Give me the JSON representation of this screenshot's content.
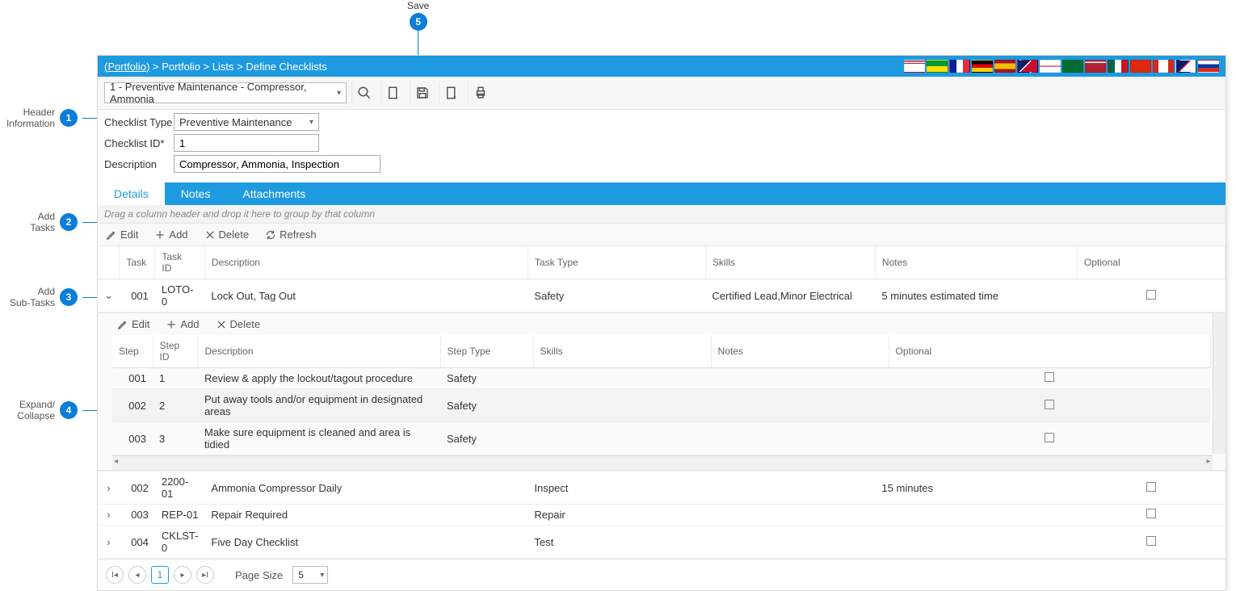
{
  "callouts": {
    "c1": "Header\nInformation",
    "c2": "Add\nTasks",
    "c3": "Add\nSub-Tasks",
    "c4": "Expand/\nCollapse",
    "c5": "Save"
  },
  "breadcrumb": {
    "root": "(Portfolio)",
    "parts": [
      "Portfolio",
      "Lists",
      "Define Checklists"
    ],
    "sep": " > "
  },
  "selector": {
    "value": "1 - Preventive Maintenance - Compressor, Ammonia"
  },
  "form": {
    "type_label": "Checklist Type",
    "type_value": "Preventive Maintenance",
    "id_label": "Checklist ID*",
    "id_value": "1",
    "desc_label": "Description",
    "desc_value": "Compressor, Ammonia, Inspection"
  },
  "tabs": {
    "details": "Details",
    "notes": "Notes",
    "attachments": "Attachments"
  },
  "group_hint": "Drag a column header and drop it here to group by that column",
  "actions": {
    "edit": "Edit",
    "add": "Add",
    "del": "Delete",
    "refresh": "Refresh"
  },
  "columns": {
    "task": "Task",
    "task_id": "Task\nID",
    "desc": "Description",
    "task_type": "Task Type",
    "skills": "Skills",
    "notes": "Notes",
    "optional": "Optional"
  },
  "tasks": [
    {
      "expanded": true,
      "task": "001",
      "task_id": "LOTO-0",
      "desc": "Lock Out, Tag Out",
      "type": "Safety",
      "skills": "Certified Lead,Minor Electrical",
      "notes": "5 minutes estimated time",
      "optional": false
    },
    {
      "expanded": false,
      "task": "002",
      "task_id": "2200-01",
      "desc": "Ammonia Compressor Daily",
      "type": "Inspect",
      "skills": "",
      "notes": "15 minutes",
      "optional": false
    },
    {
      "expanded": false,
      "task": "003",
      "task_id": "REP-01",
      "desc": "Repair Required",
      "type": "Repair",
      "skills": "",
      "notes": "",
      "optional": false
    },
    {
      "expanded": false,
      "task": "004",
      "task_id": "CKLST-0",
      "desc": "Five Day Checklist",
      "type": "Test",
      "skills": "",
      "notes": "",
      "optional": false
    }
  ],
  "sub_columns": {
    "step": "Step",
    "step_id": "Step ID",
    "desc": "Description",
    "step_type": "Step Type",
    "skills": "Skills",
    "notes": "Notes",
    "optional": "Optional"
  },
  "sub_tasks": [
    {
      "step": "001",
      "step_id": "1",
      "desc": "Review & apply the lockout/tagout procedure",
      "type": "Safety"
    },
    {
      "step": "002",
      "step_id": "2",
      "desc": "Put away tools and/or equipment in designated areas",
      "type": "Safety"
    },
    {
      "step": "003",
      "step_id": "3",
      "desc": "Make sure equipment is cleaned and area is tidied",
      "type": "Safety"
    }
  ],
  "pager": {
    "page": "1",
    "page_size_label": "Page Size",
    "page_size": "5"
  },
  "flags": [
    "linear-gradient(to bottom,#b22234 10%,#fff 10%,#fff 20%,#b22234 20%,#b22234 30%,#fff 30%)",
    "linear-gradient(to bottom,#009b3a 50%,#fedf00 50%)",
    "linear-gradient(to right,#002395 33%,#fff 33%,#fff 66%,#ed2939 66%)",
    "linear-gradient(to bottom,#000 33%,#dd0000 33%,#dd0000 66%,#ffce00 66%)",
    "linear-gradient(to bottom,#aa151b 25%,#f1bf00 25%,#f1bf00 75%,#aa151b 75%)",
    "linear-gradient(135deg,#012169 40%,#fff 40%,#fff 45%,#c8102e 45%)",
    "linear-gradient(to bottom,#fff 48%,#bc002d 48%,#bc002d 52%,#fff 52%)",
    "linear-gradient(to right,#006c35,#006c35)",
    "linear-gradient(to bottom,#b22234 10%,#fff 10%,#fff 20%,#b22234 20%)",
    "linear-gradient(to right,#006847 33%,#fff 33%,#fff 66%,#ce1126 66%)",
    "linear-gradient(to bottom,#de2910,#de2910)",
    "linear-gradient(to right,#d52b1e 25%,#fff 25%,#fff 75%,#d52b1e 75%)",
    "linear-gradient(135deg,#012169 40%,#c8102e 45%,#fff 50%)",
    "linear-gradient(to bottom,#fff 33%,#0039a6 33%,#0039a6 66%,#d52b1e 66%)"
  ]
}
